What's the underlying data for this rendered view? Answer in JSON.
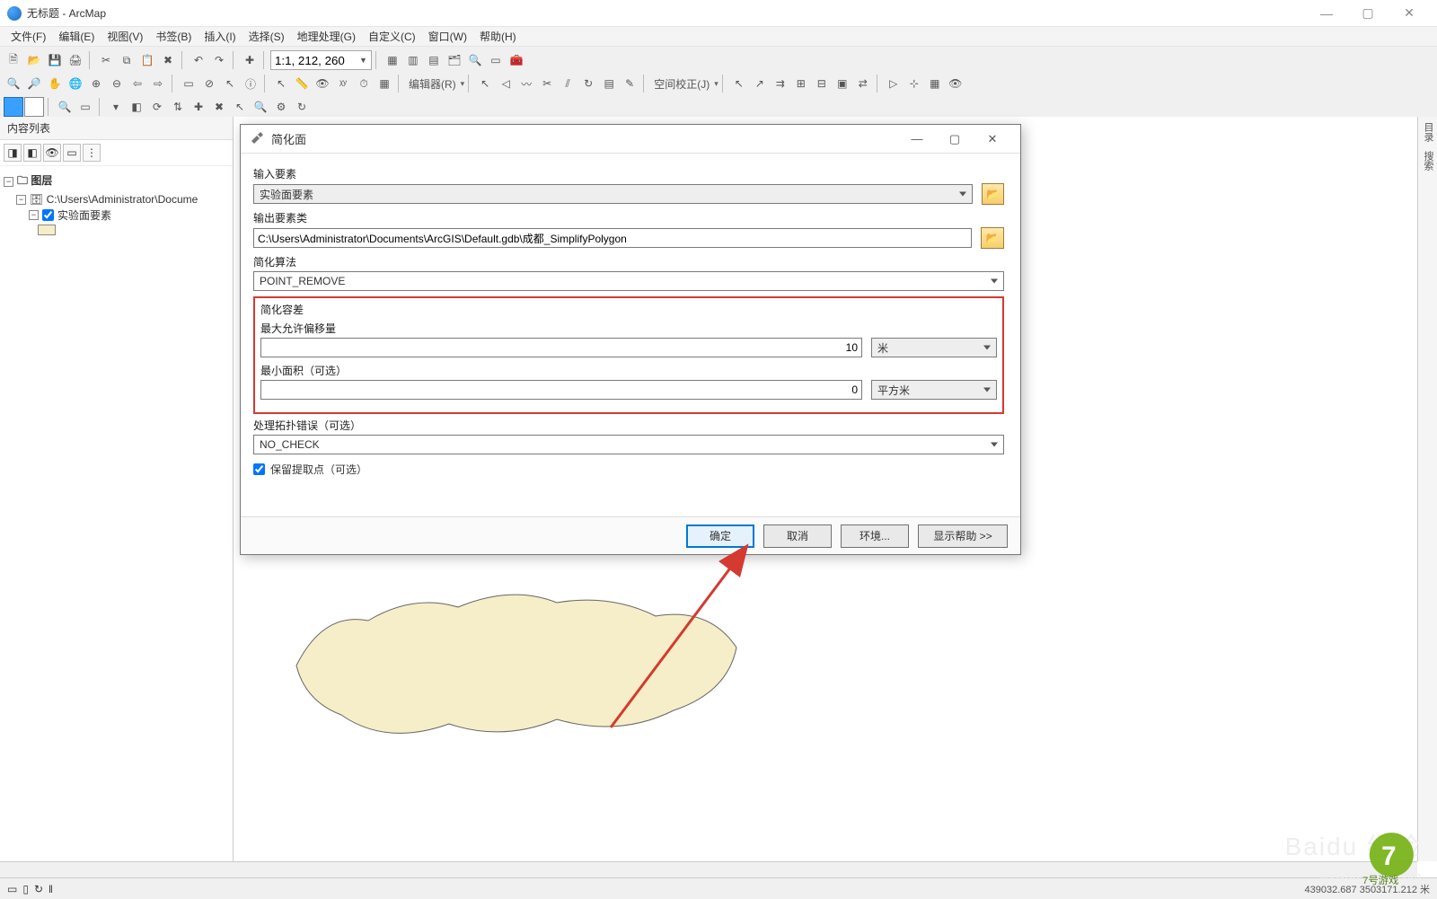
{
  "window": {
    "title": "无标题 - ArcMap"
  },
  "menus": [
    "文件(F)",
    "编辑(E)",
    "视图(V)",
    "书签(B)",
    "插入(I)",
    "选择(S)",
    "地理处理(G)",
    "自定义(C)",
    "窗口(W)",
    "帮助(H)"
  ],
  "toolbar": {
    "scale": "1:1, 212, 260",
    "editor_label": "编辑器(R)",
    "spatial_adjust_label": "空间校正(J)"
  },
  "toc": {
    "title": "内容列表",
    "root": "图层",
    "dataset": "C:\\Users\\Administrator\\Docume",
    "layer": "实验面要素"
  },
  "rightdock": [
    "目录",
    "搜索"
  ],
  "dialog": {
    "title": "简化面",
    "input_label": "输入要素",
    "input_value": "实验面要素",
    "output_label": "输出要素类",
    "output_value": "C:\\Users\\Administrator\\Documents\\ArcGIS\\Default.gdb\\成都_SimplifyPolygon",
    "algo_label": "简化算法",
    "algo_value": "POINT_REMOVE",
    "tol_title": "简化容差",
    "tol_label": "最大允许偏移量",
    "tol_value": "10",
    "tol_unit": "米",
    "area_label": "最小面积（可选）",
    "area_value": "0",
    "area_unit": "平方米",
    "topo_label": "处理拓扑错误（可选）",
    "topo_value": "NO_CHECK",
    "keep_label": "保留提取点（可选）",
    "ok": "确定",
    "cancel": "取消",
    "env": "环境...",
    "help": "显示帮助 >>"
  },
  "status": {
    "coords": "439032.687  3503171.212 米"
  },
  "watermark": {
    "big": "Baidu 经验",
    "small": "jingyan.baidu.com",
    "logo": "7号游戏"
  }
}
